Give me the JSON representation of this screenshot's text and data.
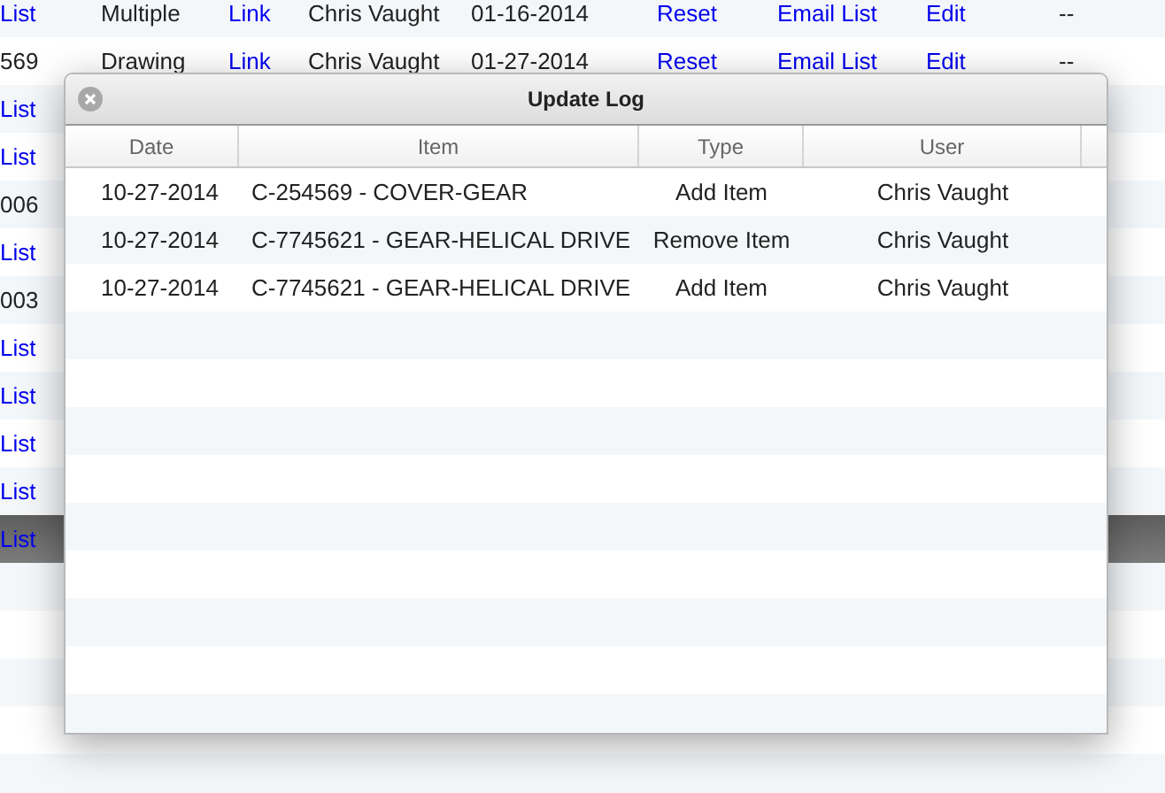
{
  "background_table": {
    "rows": [
      {
        "cells": [
          "List",
          "Multiple",
          "Link",
          "Chris Vaught",
          "01-16-2014",
          "Reset",
          "Email List",
          "Edit",
          "--"
        ],
        "selected": false
      },
      {
        "cells": [
          "569",
          "Drawing",
          "Link",
          "Chris Vaught",
          "01-27-2014",
          "Reset",
          "Email List",
          "Edit",
          "--"
        ],
        "selected": false
      },
      {
        "cells": [
          "List"
        ],
        "selected": false
      },
      {
        "cells": [
          "List"
        ],
        "selected": false
      },
      {
        "cells": [
          "006"
        ],
        "selected": false
      },
      {
        "cells": [
          "List"
        ],
        "selected": false
      },
      {
        "cells": [
          "003"
        ],
        "selected": false
      },
      {
        "cells": [
          "List"
        ],
        "selected": false
      },
      {
        "cells": [
          "List"
        ],
        "selected": false
      },
      {
        "cells": [
          "List"
        ],
        "selected": false
      },
      {
        "cells": [
          "List"
        ],
        "selected": false
      },
      {
        "cells": [
          "List"
        ],
        "selected": true
      }
    ]
  },
  "dialog": {
    "title": "Update Log",
    "columns": [
      "Date",
      "Item",
      "Type",
      "User"
    ],
    "rows": [
      {
        "date": "10-27-2014",
        "item": "C-254569 - COVER-GEAR",
        "type": "Add Item",
        "user": "Chris Vaught"
      },
      {
        "date": "10-27-2014",
        "item": "C-7745621 - GEAR-HELICAL DRIVE",
        "type": "Remove Item",
        "user": "Chris Vaught"
      },
      {
        "date": "10-27-2014",
        "item": "C-7745621 - GEAR-HELICAL DRIVE",
        "type": "Add Item",
        "user": "Chris Vaught"
      }
    ]
  }
}
